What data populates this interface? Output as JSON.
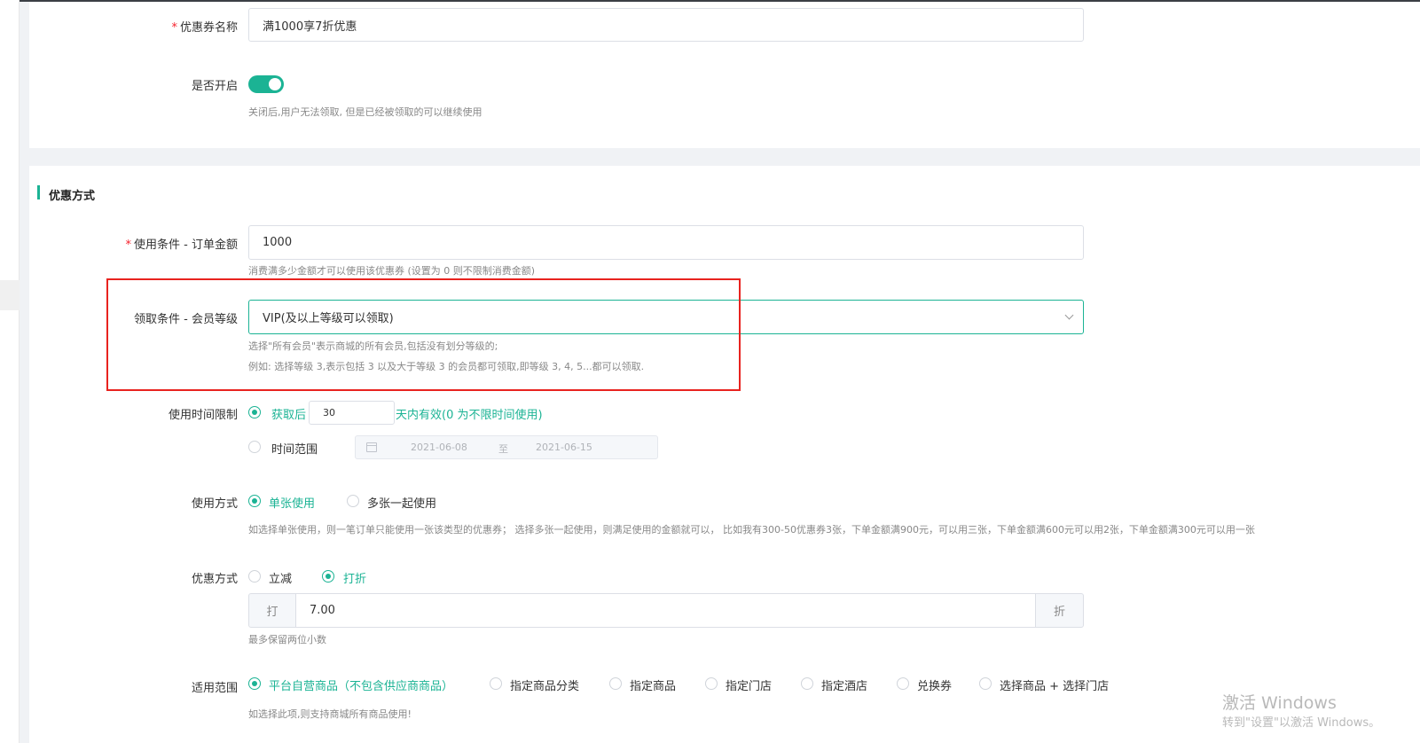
{
  "coupon_name": {
    "label": "优惠券名称",
    "required_mark": "*",
    "value": "满1000享7折优惠"
  },
  "enabled": {
    "label": "是否开启",
    "on": true,
    "help": "关闭后,用户无法领取, 但是已经被领取的可以继续使用"
  },
  "section_title": "优惠方式",
  "order_amount": {
    "label": "使用条件 - 订单金额",
    "required_mark": "*",
    "value": "1000",
    "help": "消费满多少金额才可以使用该优惠券 (设置为 0 则不限制消费金额)"
  },
  "member_level": {
    "label": "领取条件 - 会员等级",
    "selected": "VIP(及以上等级可以领取)",
    "help1": "选择\"所有会员\"表示商城的所有会员,包括没有划分等级的;",
    "help2": "例如: 选择等级 3,表示包括 3 以及大于等级 3 的会员都可领取,即等级 3, 4, 5...都可以领取."
  },
  "time_limit": {
    "label": "使用时间限制",
    "opt1_prefix": "获取后",
    "opt1_days": "30",
    "opt1_suffix": "天内有效(0 为不限时间使用)",
    "opt2": "时间范围",
    "start_date": "2021-06-08",
    "sep": "至",
    "end_date": "2021-06-15"
  },
  "usage_mode": {
    "label": "使用方式",
    "opt1": "单张使用",
    "opt2": "多张一起使用",
    "help": "如选择单张使用，则一笔订单只能使用一张该类型的优惠券； 选择多张一起使用，则满足使用的金额就可以， 比如我有300-50优惠券3张，下单金额满900元，可以用三张，下单金额满600元可以用2张，下单金额满300元可以用一张"
  },
  "discount_type": {
    "label": "优惠方式",
    "opt1": "立减",
    "opt2": "打折",
    "prefix": "打",
    "value": "7.00",
    "suffix": "折",
    "help": "最多保留两位小数"
  },
  "scope": {
    "label": "适用范围",
    "options": [
      "平台自营商品（不包含供应商商品）",
      "指定商品分类",
      "指定商品",
      "指定门店",
      "指定酒店",
      "兑换券",
      "选择商品 + 选择门店"
    ],
    "help": "如选择此项,则支持商城所有商品使用!"
  },
  "watermark": {
    "line1": "激活 Windows",
    "line2": "转到\"设置\"以激活 Windows。"
  },
  "colors": {
    "accent": "#1bb394",
    "highlight": "#e8231f"
  }
}
